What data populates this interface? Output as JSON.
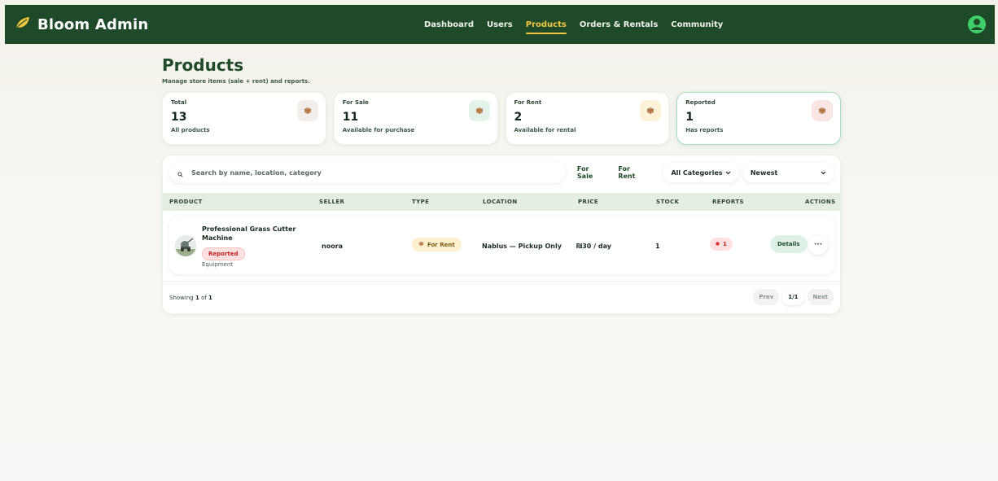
{
  "app": {
    "brand": "Bloom Admin"
  },
  "nav": {
    "items": [
      {
        "label": "Dashboard"
      },
      {
        "label": "Users"
      },
      {
        "label": "Products",
        "active": true
      },
      {
        "label": "Orders & Rentals"
      },
      {
        "label": "Community"
      }
    ]
  },
  "page": {
    "title": "Products",
    "subtitle": "Manage store items (sale + rent) and reports."
  },
  "stats": [
    {
      "label": "Total",
      "value": "13",
      "desc": "All products",
      "badge_color": "#f1eeec"
    },
    {
      "label": "For Sale",
      "value": "11",
      "desc": "Available for purchase",
      "badge_color": "#e4f3ea"
    },
    {
      "label": "For Rent",
      "value": "2",
      "desc": "Available for rental",
      "badge_color": "#fdf1d8"
    },
    {
      "label": "Reported",
      "value": "1",
      "desc": "Has reports",
      "badge_color": "#fbe4e4"
    }
  ],
  "filters": {
    "search_placeholder": "Search by name, location, category",
    "for_sale": "For Sale",
    "for_rent": "For Rent",
    "category": "All Categories",
    "sort": "Newest"
  },
  "table": {
    "headers": {
      "product": "PRODUCT",
      "seller": "SELLER",
      "type": "TYPE",
      "location": "LOCATION",
      "price": "PRICE",
      "stock": "STOCK",
      "reports": "REPORTS",
      "actions": "ACTIONS"
    },
    "rows": [
      {
        "name": "Professional Grass Cutter Machine",
        "reported_label": "Reported",
        "category": "Equipment",
        "seller": "noora",
        "type": "For Rent",
        "location": "Nablus — Pickup Only",
        "price": "₪30 / day",
        "stock": "1",
        "reports": "1",
        "details_label": "Details",
        "more_label": "···"
      }
    ]
  },
  "footer": {
    "showing_prefix": "Showing",
    "showing_count": "1",
    "showing_of": "of",
    "showing_total": "1",
    "prev": "Prev",
    "page": "1/1",
    "next": "Next"
  },
  "colors": {
    "nav_bg": "#1f4a2a",
    "accent": "#f2c640",
    "reported": "#c02222"
  }
}
